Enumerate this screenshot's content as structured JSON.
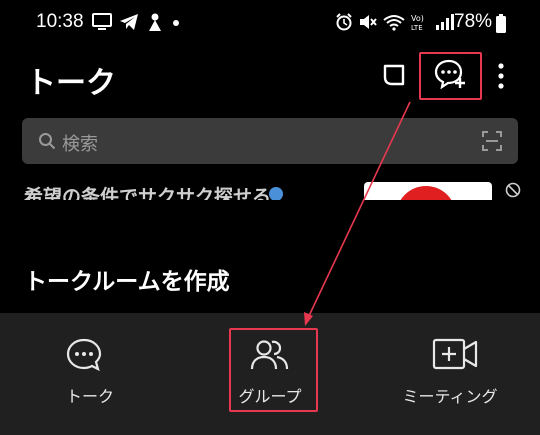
{
  "status_bar": {
    "time": "10:38",
    "battery": "78%",
    "network": "Vo) LTE",
    "icons_left": [
      "screen-icon",
      "telegram-icon",
      "app-icon",
      "dot-icon"
    ],
    "icons_right": [
      "alarm-icon",
      "mute-icon",
      "wifi-icon",
      "lte-icon",
      "signal-icon",
      "battery-icon"
    ]
  },
  "header": {
    "title": "トーク",
    "icons": [
      "open-chat-icon",
      "new-chat-icon",
      "more-vert-icon"
    ]
  },
  "search": {
    "placeholder": "検索"
  },
  "ad": {
    "text": "希望の条件でサクサク探せる"
  },
  "sheet": {
    "title": "トークルームを作成"
  },
  "bottom_options": [
    {
      "label": "トーク",
      "icon": "chat-bubble-icon"
    },
    {
      "label": "グループ",
      "icon": "group-icon"
    },
    {
      "label": "ミーティング",
      "icon": "video-add-icon"
    }
  ],
  "colors": {
    "background": "#000000",
    "bottom_bar": "#202020",
    "search_bg": "#3b3b3b",
    "highlight": "#e8384f"
  }
}
